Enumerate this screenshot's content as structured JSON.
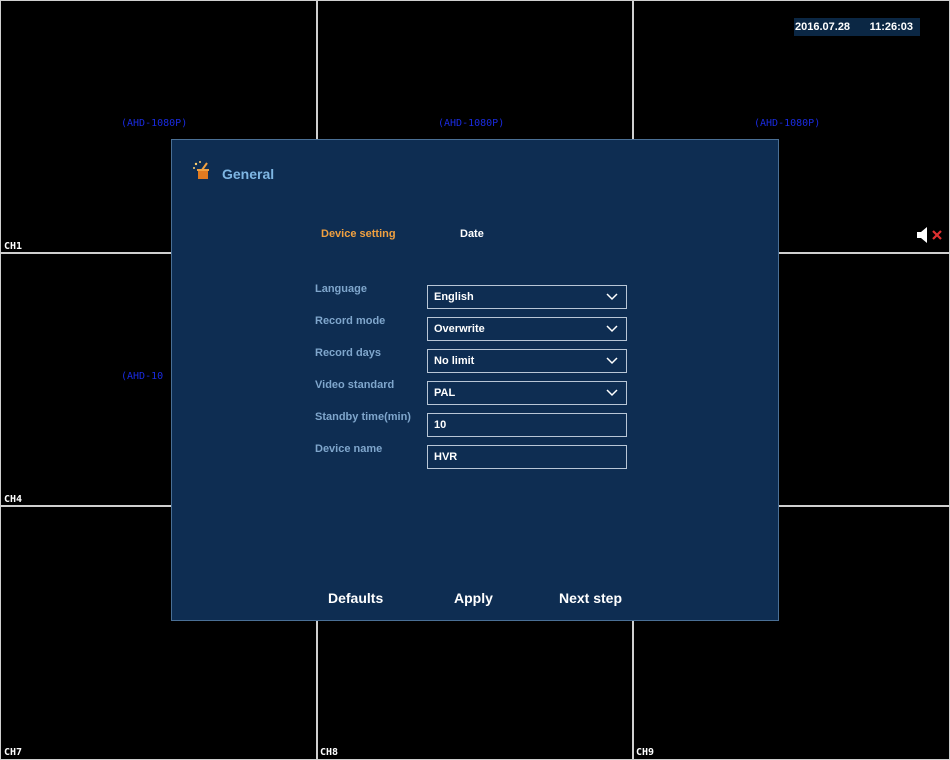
{
  "datetime": {
    "date": "2016.07.28",
    "time": "11:26:03"
  },
  "channels": {
    "ch1": "CH1",
    "ch4": "CH4",
    "ch7": "CH7",
    "ch8": "CH8",
    "ch9": "CH9"
  },
  "resolution_labels": [
    "(AHD-1080P)",
    "(AHD-1080P)",
    "(AHD-1080P)",
    "(AHD-10"
  ],
  "mute_icon": "speaker-muted-icon",
  "dialog": {
    "icon": "wizard-icon",
    "title": "General",
    "tabs": {
      "device_setting": "Device setting",
      "date": "Date"
    },
    "fields": {
      "language": {
        "label": "Language",
        "value": "English"
      },
      "record_mode": {
        "label": "Record mode",
        "value": "Overwrite"
      },
      "record_days": {
        "label": "Record days",
        "value": "No limit"
      },
      "video_standard": {
        "label": "Video standard",
        "value": "PAL"
      },
      "standby_time": {
        "label": "Standby time(min)",
        "value": "10"
      },
      "device_name": {
        "label": "Device name",
        "value": "HVR"
      }
    },
    "buttons": {
      "defaults": "Defaults",
      "apply": "Apply",
      "next": "Next step"
    }
  },
  "colors": {
    "dialog_bg": "#0e2d52",
    "accent": "#f0a040",
    "label": "#7fa6cc",
    "res_blue": "#1a2be0"
  }
}
